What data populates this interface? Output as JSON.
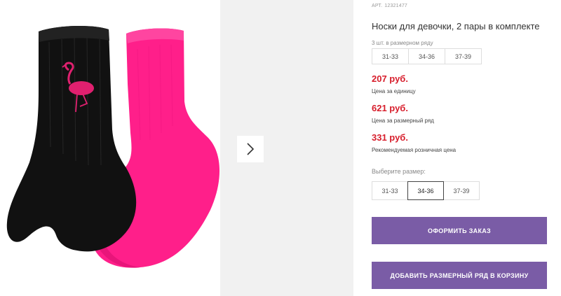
{
  "product": {
    "sku_label": "АРТ.",
    "sku_value": "12321477",
    "title": "Носки для девочки, 2 пары в комплекте",
    "pack_note": "3 шт. в размерном ряду",
    "pack_sizes": [
      "31-33",
      "34-36",
      "37-39"
    ]
  },
  "prices": [
    {
      "value": "207 руб.",
      "label": "Цена за единицу"
    },
    {
      "value": "621 руб.",
      "label": "Цена за размерный ряд"
    },
    {
      "value": "331 руб.",
      "label": "Рекомендуемая розничная цена"
    }
  ],
  "size_select": {
    "label": "Выберите размер:",
    "options": [
      "31-33",
      "34-36",
      "37-39"
    ],
    "selected": "34-36"
  },
  "buttons": {
    "order": "Оформить заказ",
    "add_to_cart": "Добавить размерный ряд в корзину"
  },
  "colors": {
    "accent_button": "#7a5ca6",
    "price": "#d71d2b",
    "sock_black": "#111111",
    "sock_pink": "#ff1f8a",
    "flamingo": "#e0206f"
  },
  "icons": {
    "next": "chevron-right-icon"
  }
}
